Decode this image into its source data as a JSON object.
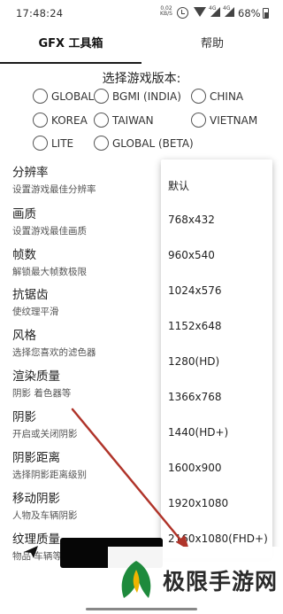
{
  "status_bar": {
    "time": "17:48:24",
    "net_speed": "0.02 KB/S",
    "net_tag_1": "4G",
    "net_tag_2": "4G",
    "battery": "68%",
    "icons": [
      "alarm-icon",
      "wifi-icon",
      "signal-icon",
      "signal-icon",
      "battery-icon"
    ]
  },
  "tabs": [
    {
      "label": "GFX 工具箱",
      "active": true
    },
    {
      "label": "帮助",
      "active": false
    }
  ],
  "version": {
    "title": "选择游戏版本:",
    "options": [
      "GLOBAL",
      "BGMI (INDIA)",
      "CHINA",
      "KOREA",
      "TAIWAN",
      "VIETNAM",
      "LITE",
      "GLOBAL (BETA)"
    ]
  },
  "settings": [
    {
      "title": "分辨率",
      "desc": "设置游戏最佳分辨率"
    },
    {
      "title": "画质",
      "desc": "设置游戏最佳画质"
    },
    {
      "title": "帧数",
      "desc": "解锁最大帧数极限"
    },
    {
      "title": "抗锯齿",
      "desc": "使纹理平滑"
    },
    {
      "title": "风格",
      "desc": "选择您喜欢的滤色器"
    },
    {
      "title": "渲染质量",
      "desc": "阴影 着色器等"
    },
    {
      "title": "阴影",
      "desc": "开启或关闭阴影"
    },
    {
      "title": "阴影距离",
      "desc": "选择阴影距离级别"
    },
    {
      "title": "移动阴影",
      "desc": "人物及车辆阴影"
    },
    {
      "title": "纹理质量",
      "desc": "物品 车辆等"
    }
  ],
  "resolution_dropdown": {
    "options": [
      "默认",
      "768x432",
      "960x540",
      "1024x576",
      "1152x648",
      "1280(HD)",
      "1366x768",
      "1440(HD+)",
      "1600x900",
      "1920x1080",
      "2160x1080(FHD+)"
    ]
  },
  "watermark": {
    "text": "极限手游网"
  },
  "colors": {
    "arrow": "#b0342a",
    "logo_green": "#1e8a3c",
    "logo_yellow": "#f0b400",
    "button_black": "#060606"
  }
}
